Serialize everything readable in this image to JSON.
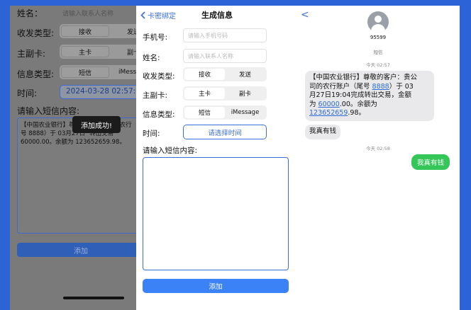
{
  "left": {
    "name_label": "姓名：",
    "name_placeholder": "请输入联系人名称",
    "type_label": "收发类型:",
    "type_options": [
      "接收",
      "发送"
    ],
    "card_label": "主副卡:",
    "card_options": [
      "主卡",
      "副卡"
    ],
    "msg_type_label": "信息类型:",
    "msg_type_options": [
      "短信",
      "iMessage"
    ],
    "time_label": "时间:",
    "time_value": "2024-03-28 02:57:03",
    "content_label": "请输入短信内容:",
    "content_line1": "【中国农业银行】尊",
    "content_line1b": "司的农行",
    "content_line2": "号 8888）于 03月27日",
    "content_line2b": "转出交易",
    "content_line3": "60000.00。余额为 123652659.98。",
    "toast": "添加成功!",
    "add_button": "添加"
  },
  "mid": {
    "back_label": "卡密绑定",
    "title": "生成信息",
    "phone_label": "手机号:",
    "phone_placeholder": "请输入手机号码",
    "name_label": "姓名:",
    "name_placeholder": "请输入联系人名称",
    "type_label": "收发类型:",
    "type_options": [
      "接收",
      "发送"
    ],
    "card_label": "主副卡:",
    "card_options": [
      "主卡",
      "副卡"
    ],
    "msg_type_label": "信息类型:",
    "msg_type_options": [
      "短信",
      "iMessage"
    ],
    "time_label": "时间:",
    "time_button": "请选择时间",
    "content_label": "请输入短信内容:",
    "add_button": "添加"
  },
  "right": {
    "back": "<",
    "contact": "95599",
    "sub": "短信",
    "ts1": "今天 02:57",
    "msg_l1": "【中国农业银行】尊敬的客户：贵公",
    "msg_l2a": "司的农行账户（尾号 ",
    "msg_l2b": "8888",
    "msg_l2c": "）于 03",
    "msg_l3": "月27日19:04完成转出交易，金额",
    "msg_l4a": "为 ",
    "msg_l4b": "60000",
    "msg_l4c": ".00。余额为",
    "msg_l5a": "123652659",
    "msg_l5b": ".98。",
    "reply_in": "我真有钱",
    "ts2": "今天 02:58",
    "reply_out": "我真有钱"
  },
  "colors": {
    "background": "#2c63d6",
    "accent": "#3a6fd8",
    "bubble_out": "#35c659",
    "bubble_in": "#e9e9eb"
  }
}
